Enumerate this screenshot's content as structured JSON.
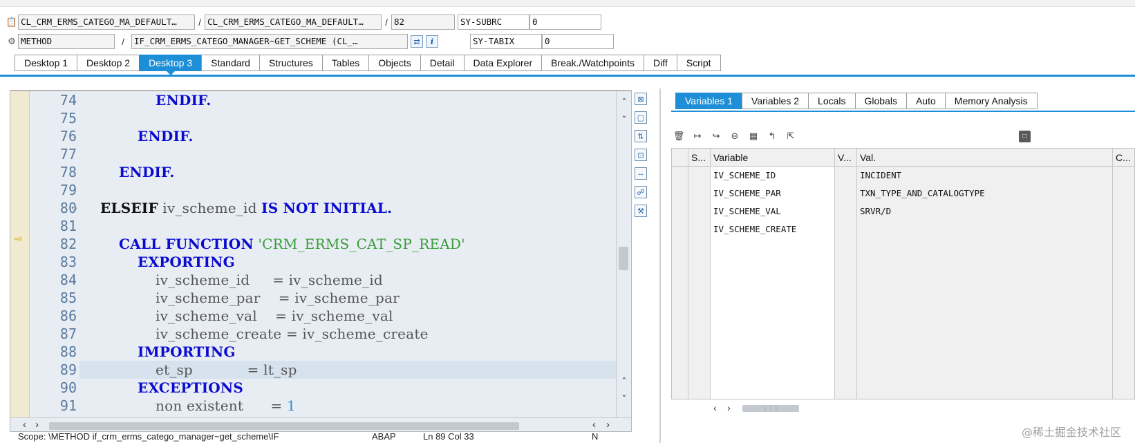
{
  "header": {
    "row1": {
      "field1": "CL_CRM_ERMS_CATEGO_MA_DEFAULT…",
      "field2": "CL_CRM_ERMS_CATEGO_MA_DEFAULT…",
      "line": "82",
      "sysfield": "SY-SUBRC",
      "sysvalue": "0"
    },
    "row2": {
      "field1": "METHOD",
      "field2": "IF_CRM_ERMS_CATEGO_MANAGER~GET_SCHEME (CL_…",
      "sysfield": "SY-TABIX",
      "sysvalue": "0"
    },
    "sep": "/"
  },
  "tabs": [
    "Desktop 1",
    "Desktop 2",
    "Desktop 3",
    "Standard",
    "Structures",
    "Tables",
    "Objects",
    "Detail",
    "Data Explorer",
    "Break./Watchpoints",
    "Diff",
    "Script"
  ],
  "active_tab": "Desktop 3",
  "code": {
    "lines": [
      {
        "num": "74",
        "fold": "-"
      },
      {
        "num": "75",
        "fold": ""
      },
      {
        "num": "76",
        "fold": "-"
      },
      {
        "num": "77",
        "fold": ""
      },
      {
        "num": "78",
        "fold": "-"
      },
      {
        "num": "79",
        "fold": ""
      },
      {
        "num": "80",
        "fold": "○"
      },
      {
        "num": "81",
        "fold": ""
      },
      {
        "num": "82",
        "fold": ""
      },
      {
        "num": "83",
        "fold": ""
      },
      {
        "num": "84",
        "fold": ""
      },
      {
        "num": "85",
        "fold": ""
      },
      {
        "num": "86",
        "fold": ""
      },
      {
        "num": "87",
        "fold": ""
      },
      {
        "num": "88",
        "fold": ""
      },
      {
        "num": "89",
        "fold": ""
      },
      {
        "num": "90",
        "fold": ""
      },
      {
        "num": "91",
        "fold": ""
      }
    ],
    "text": {
      "l74": "ENDIF.",
      "l76": "ENDIF.",
      "l78": "ENDIF.",
      "l80_kw": "ELSEIF",
      "l80_id": " iv_scheme_id ",
      "l80_kw2": "IS NOT INITIAL.",
      "l82_kw": "CALL FUNCTION",
      "l82_str": " 'CRM_ERMS_CAT_SP_READ'",
      "l83": "EXPORTING",
      "l84": "iv_scheme_id     = iv_scheme_id",
      "l85": "iv_scheme_par    = iv_scheme_par",
      "l86": "iv_scheme_val    = iv_scheme_val",
      "l87": "iv_scheme_create = iv_scheme_create",
      "l88": "IMPORTING",
      "l89": "et_sp            = lt_sp",
      "l90": "EXCEPTIONS",
      "l91_id": "non existent      = ",
      "l91_num": "1"
    },
    "current_line": "89",
    "exec_line": "82"
  },
  "variables": {
    "tabs": [
      "Variables 1",
      "Variables 2",
      "Locals",
      "Globals",
      "Auto",
      "Memory Analysis"
    ],
    "active_tab": "Variables 1",
    "columns": [
      "S...",
      "Variable",
      "V...",
      "Val.",
      "C..."
    ],
    "rows": [
      {
        "variable": "IV_SCHEME_ID",
        "value": "INCIDENT"
      },
      {
        "variable": "IV_SCHEME_PAR",
        "value": "TXN_TYPE_AND_CATALOGTYPE"
      },
      {
        "variable": "IV_SCHEME_VAL",
        "value": "SRVR/D"
      },
      {
        "variable": "IV_SCHEME_CREATE",
        "value": ""
      }
    ],
    "empty_rows": 9
  },
  "status": {
    "scope": "Scope: \\METHOD if_crm_erms_catego_manager~get_scheme\\IF",
    "lang": "ABAP",
    "pos": "Ln 89 Col 33",
    "mode": "N"
  },
  "watermark": "@稀土掘金技术社区",
  "icons": {
    "program": "program-icon",
    "method": "method-icon",
    "navigate": "navigate-icon",
    "info": "info-icon",
    "arrow": "exec-arrow-icon"
  }
}
